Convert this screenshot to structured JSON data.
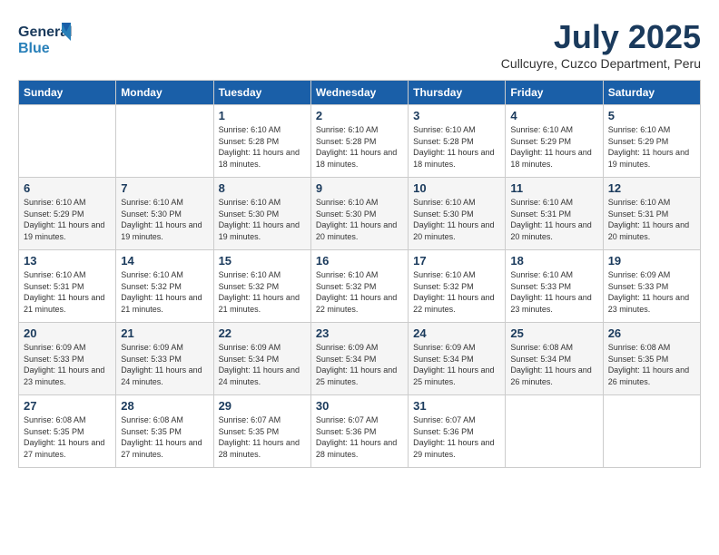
{
  "header": {
    "logo": "GeneralBlue",
    "month_year": "July 2025",
    "location": "Cullcuyre, Cuzco Department, Peru"
  },
  "days_of_week": [
    "Sunday",
    "Monday",
    "Tuesday",
    "Wednesday",
    "Thursday",
    "Friday",
    "Saturday"
  ],
  "weeks": [
    [
      {
        "day": "",
        "info": ""
      },
      {
        "day": "",
        "info": ""
      },
      {
        "day": "1",
        "info": "Sunrise: 6:10 AM\nSunset: 5:28 PM\nDaylight: 11 hours and 18 minutes."
      },
      {
        "day": "2",
        "info": "Sunrise: 6:10 AM\nSunset: 5:28 PM\nDaylight: 11 hours and 18 minutes."
      },
      {
        "day": "3",
        "info": "Sunrise: 6:10 AM\nSunset: 5:28 PM\nDaylight: 11 hours and 18 minutes."
      },
      {
        "day": "4",
        "info": "Sunrise: 6:10 AM\nSunset: 5:29 PM\nDaylight: 11 hours and 18 minutes."
      },
      {
        "day": "5",
        "info": "Sunrise: 6:10 AM\nSunset: 5:29 PM\nDaylight: 11 hours and 19 minutes."
      }
    ],
    [
      {
        "day": "6",
        "info": "Sunrise: 6:10 AM\nSunset: 5:29 PM\nDaylight: 11 hours and 19 minutes."
      },
      {
        "day": "7",
        "info": "Sunrise: 6:10 AM\nSunset: 5:30 PM\nDaylight: 11 hours and 19 minutes."
      },
      {
        "day": "8",
        "info": "Sunrise: 6:10 AM\nSunset: 5:30 PM\nDaylight: 11 hours and 19 minutes."
      },
      {
        "day": "9",
        "info": "Sunrise: 6:10 AM\nSunset: 5:30 PM\nDaylight: 11 hours and 20 minutes."
      },
      {
        "day": "10",
        "info": "Sunrise: 6:10 AM\nSunset: 5:30 PM\nDaylight: 11 hours and 20 minutes."
      },
      {
        "day": "11",
        "info": "Sunrise: 6:10 AM\nSunset: 5:31 PM\nDaylight: 11 hours and 20 minutes."
      },
      {
        "day": "12",
        "info": "Sunrise: 6:10 AM\nSunset: 5:31 PM\nDaylight: 11 hours and 20 minutes."
      }
    ],
    [
      {
        "day": "13",
        "info": "Sunrise: 6:10 AM\nSunset: 5:31 PM\nDaylight: 11 hours and 21 minutes."
      },
      {
        "day": "14",
        "info": "Sunrise: 6:10 AM\nSunset: 5:32 PM\nDaylight: 11 hours and 21 minutes."
      },
      {
        "day": "15",
        "info": "Sunrise: 6:10 AM\nSunset: 5:32 PM\nDaylight: 11 hours and 21 minutes."
      },
      {
        "day": "16",
        "info": "Sunrise: 6:10 AM\nSunset: 5:32 PM\nDaylight: 11 hours and 22 minutes."
      },
      {
        "day": "17",
        "info": "Sunrise: 6:10 AM\nSunset: 5:32 PM\nDaylight: 11 hours and 22 minutes."
      },
      {
        "day": "18",
        "info": "Sunrise: 6:10 AM\nSunset: 5:33 PM\nDaylight: 11 hours and 23 minutes."
      },
      {
        "day": "19",
        "info": "Sunrise: 6:09 AM\nSunset: 5:33 PM\nDaylight: 11 hours and 23 minutes."
      }
    ],
    [
      {
        "day": "20",
        "info": "Sunrise: 6:09 AM\nSunset: 5:33 PM\nDaylight: 11 hours and 23 minutes."
      },
      {
        "day": "21",
        "info": "Sunrise: 6:09 AM\nSunset: 5:33 PM\nDaylight: 11 hours and 24 minutes."
      },
      {
        "day": "22",
        "info": "Sunrise: 6:09 AM\nSunset: 5:34 PM\nDaylight: 11 hours and 24 minutes."
      },
      {
        "day": "23",
        "info": "Sunrise: 6:09 AM\nSunset: 5:34 PM\nDaylight: 11 hours and 25 minutes."
      },
      {
        "day": "24",
        "info": "Sunrise: 6:09 AM\nSunset: 5:34 PM\nDaylight: 11 hours and 25 minutes."
      },
      {
        "day": "25",
        "info": "Sunrise: 6:08 AM\nSunset: 5:34 PM\nDaylight: 11 hours and 26 minutes."
      },
      {
        "day": "26",
        "info": "Sunrise: 6:08 AM\nSunset: 5:35 PM\nDaylight: 11 hours and 26 minutes."
      }
    ],
    [
      {
        "day": "27",
        "info": "Sunrise: 6:08 AM\nSunset: 5:35 PM\nDaylight: 11 hours and 27 minutes."
      },
      {
        "day": "28",
        "info": "Sunrise: 6:08 AM\nSunset: 5:35 PM\nDaylight: 11 hours and 27 minutes."
      },
      {
        "day": "29",
        "info": "Sunrise: 6:07 AM\nSunset: 5:35 PM\nDaylight: 11 hours and 28 minutes."
      },
      {
        "day": "30",
        "info": "Sunrise: 6:07 AM\nSunset: 5:36 PM\nDaylight: 11 hours and 28 minutes."
      },
      {
        "day": "31",
        "info": "Sunrise: 6:07 AM\nSunset: 5:36 PM\nDaylight: 11 hours and 29 minutes."
      },
      {
        "day": "",
        "info": ""
      },
      {
        "day": "",
        "info": ""
      }
    ]
  ]
}
